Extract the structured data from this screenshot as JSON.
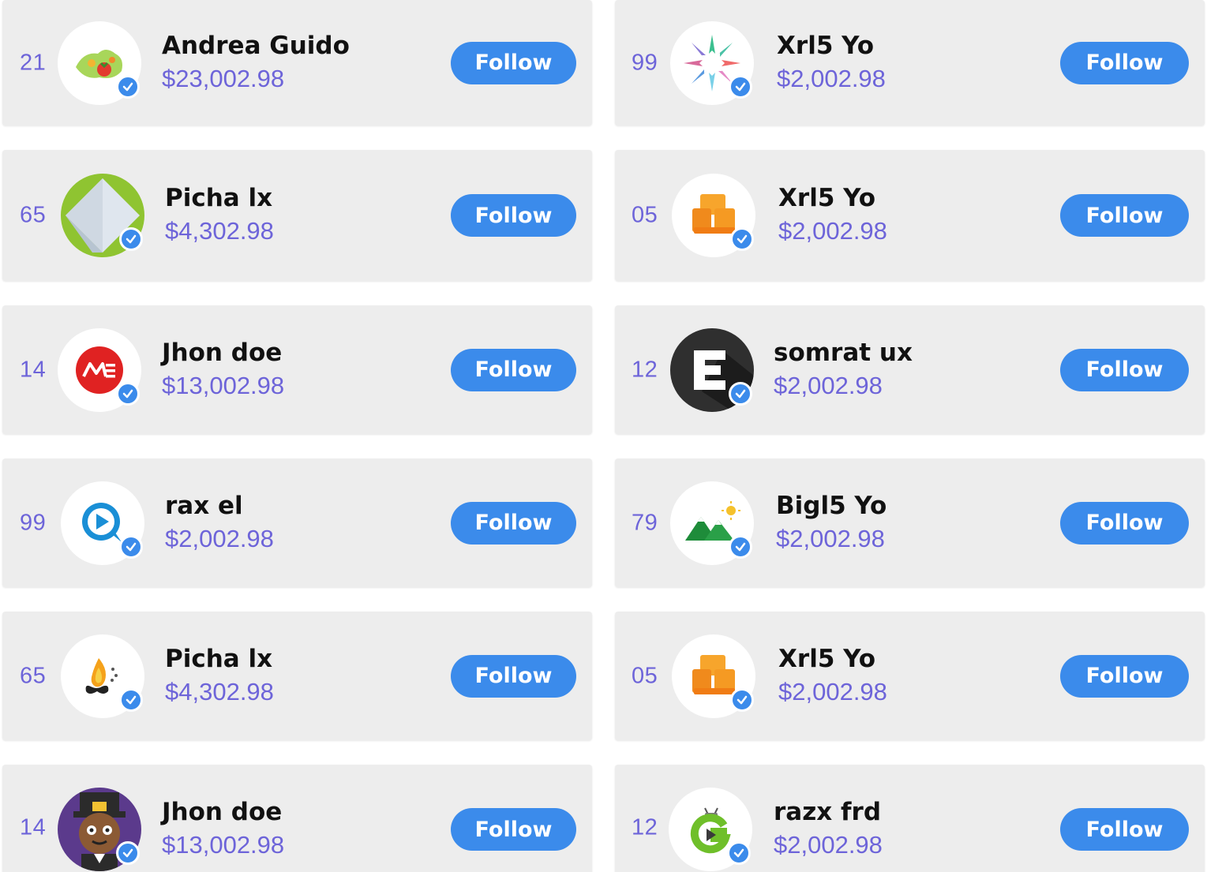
{
  "cards": [
    {
      "rank": "21",
      "name": "Andrea Guido",
      "amount": "$23,002.98",
      "avatar_icon": "vegetables-map-icon",
      "follow_label": "Follow"
    },
    {
      "rank": "99",
      "name": "Xrl5 Yo",
      "amount": "$2,002.98",
      "avatar_icon": "colorful-starburst-icon",
      "follow_label": "Follow"
    },
    {
      "rank": "65",
      "name": "Picha lx",
      "amount": "$4,302.98",
      "avatar_icon": "green-diamond-icon",
      "follow_label": "Follow"
    },
    {
      "rank": "05",
      "name": "Xrl5 Yo",
      "amount": "$2,002.98",
      "avatar_icon": "orange-blocks-icon",
      "follow_label": "Follow"
    },
    {
      "rank": "14",
      "name": "Jhon doe",
      "amount": "$13,002.98",
      "avatar_icon": "red-me-logo-icon",
      "follow_label": "Follow"
    },
    {
      "rank": "12",
      "name": "somrat ux",
      "amount": "$2,002.98",
      "avatar_icon": "letter-e-dark-icon",
      "follow_label": "Follow"
    },
    {
      "rank": "99",
      "name": "rax el",
      "amount": "$2,002.98",
      "avatar_icon": "play-chat-bubble-icon",
      "follow_label": "Follow"
    },
    {
      "rank": "79",
      "name": "Bigl5 Yo",
      "amount": "$2,002.98",
      "avatar_icon": "mountains-sun-icon",
      "follow_label": "Follow"
    },
    {
      "rank": "65",
      "name": "Picha lx",
      "amount": "$4,302.98",
      "avatar_icon": "flame-butterfly-icon",
      "follow_label": "Follow"
    },
    {
      "rank": "05",
      "name": "Xrl5 Yo",
      "amount": "$2,002.98",
      "avatar_icon": "orange-blocks-icon",
      "follow_label": "Follow"
    },
    {
      "rank": "14",
      "name": "Jhon doe",
      "amount": "$13,002.98",
      "avatar_icon": "pilgrim-character-icon",
      "follow_label": "Follow"
    },
    {
      "rank": "12",
      "name": "razx frd",
      "amount": "$2,002.98",
      "avatar_icon": "green-g-robot-icon",
      "follow_label": "Follow"
    }
  ],
  "colors": {
    "accent": "#3b8beb",
    "rank_amount": "#6d64d9",
    "card_bg": "#ededed"
  }
}
